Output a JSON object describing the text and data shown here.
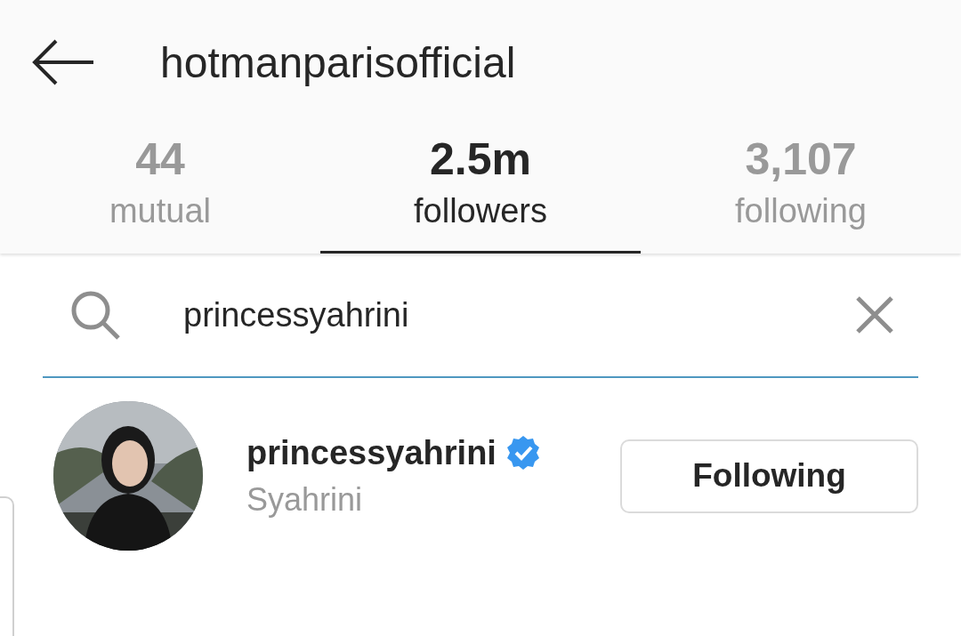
{
  "header": {
    "title": "hotmanparisofficial"
  },
  "tabs": [
    {
      "count": "44",
      "label": "mutual",
      "selected": false
    },
    {
      "count": "2.5m",
      "label": "followers",
      "selected": true
    },
    {
      "count": "3,107",
      "label": "following",
      "selected": false
    }
  ],
  "search": {
    "value": "princessyahrini"
  },
  "results": [
    {
      "username": "princessyahrini",
      "verified": true,
      "name": "Syahrini",
      "button": "Following"
    }
  ]
}
